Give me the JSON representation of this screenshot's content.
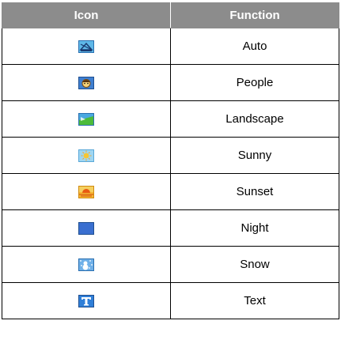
{
  "table": {
    "headers": [
      "Icon",
      "Function"
    ],
    "rows": [
      {
        "icon": "auto-scene-icon",
        "function": "Auto"
      },
      {
        "icon": "people-scene-icon",
        "function": "People"
      },
      {
        "icon": "landscape-scene-icon",
        "function": "Landscape"
      },
      {
        "icon": "sunny-scene-icon",
        "function": "Sunny"
      },
      {
        "icon": "sunset-scene-icon",
        "function": "Sunset"
      },
      {
        "icon": "night-scene-icon",
        "function": "Night"
      },
      {
        "icon": "snow-scene-icon",
        "function": "Snow"
      },
      {
        "icon": "text-scene-icon",
        "function": "Text"
      }
    ]
  },
  "colors": {
    "header_bg": "#8c8c8c",
    "header_text": "#ffffff",
    "border": "#000000"
  }
}
